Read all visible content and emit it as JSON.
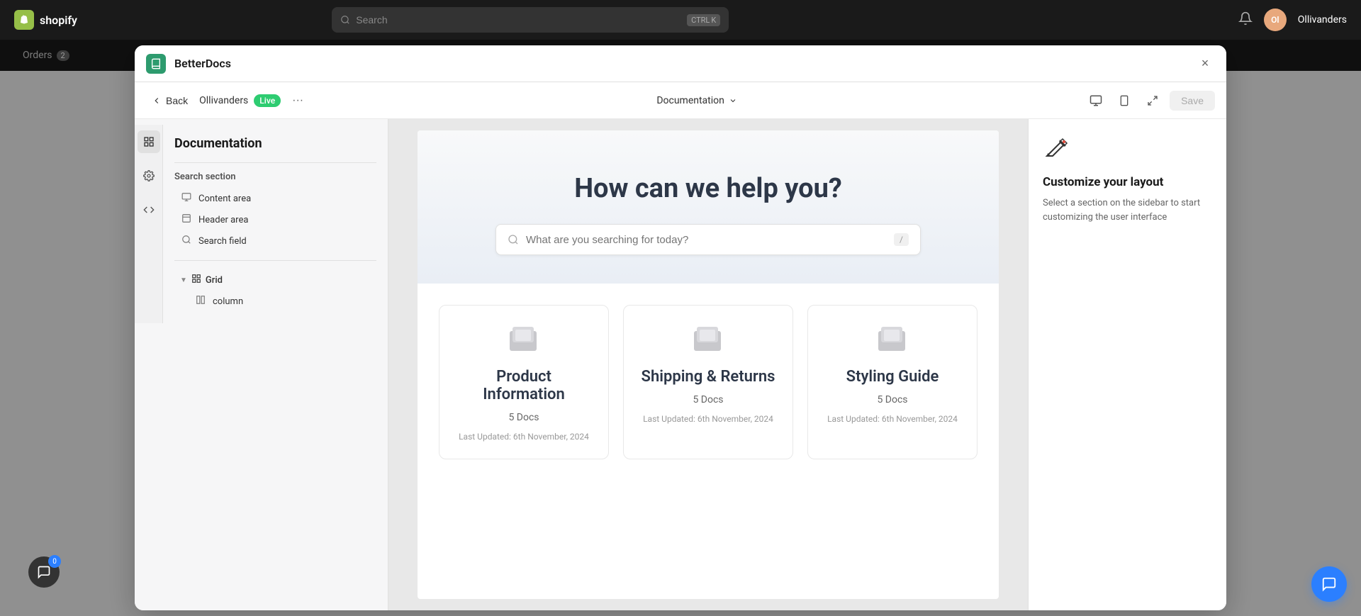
{
  "topbar": {
    "logo_text": "shopify",
    "search_placeholder": "Search",
    "search_shortcut_ctrl": "CTRL",
    "search_shortcut_key": "K",
    "username": "Ollivanders",
    "avatar_initials": "Ol"
  },
  "nav": {
    "orders_label": "Orders",
    "orders_count": "2"
  },
  "modal": {
    "app_name": "BetterDocs",
    "close_icon": "×"
  },
  "editor_toolbar": {
    "back_label": "Back",
    "store_name": "Ollivanders",
    "live_badge": "Live",
    "more_icon": "···",
    "dropdown_label": "Documentation",
    "desktop_icon": "🖥",
    "mobile_icon": "📱",
    "tablet_icon": "⊞",
    "save_label": "Save"
  },
  "sidebar": {
    "title": "Documentation",
    "search_section_label": "Search section",
    "items": [
      {
        "label": "Content area",
        "icon": "content"
      },
      {
        "label": "Header area",
        "icon": "header"
      },
      {
        "label": "Search field",
        "icon": "search"
      }
    ],
    "grid_label": "Grid",
    "grid_items": [
      {
        "label": "column",
        "icon": "column"
      }
    ]
  },
  "preview": {
    "hero_title": "How can we help you?",
    "search_placeholder": "What are you searching for today?",
    "search_shortcut": "/",
    "cards": [
      {
        "title": "Product Information",
        "count": "5 Docs",
        "date": "Last Updated: 6th November, 2024"
      },
      {
        "title": "Shipping & Returns",
        "count": "5 Docs",
        "date": "Last Updated: 6th November, 2024"
      },
      {
        "title": "Styling Guide",
        "count": "5 Docs",
        "date": "Last Updated: 6th November, 2024"
      }
    ]
  },
  "right_panel": {
    "icon": "✏️",
    "title": "Customize your layout",
    "description": "Select a section on the sidebar to start customizing the user interface"
  },
  "chat_bubble": {
    "icon": "💬",
    "count": "0"
  }
}
